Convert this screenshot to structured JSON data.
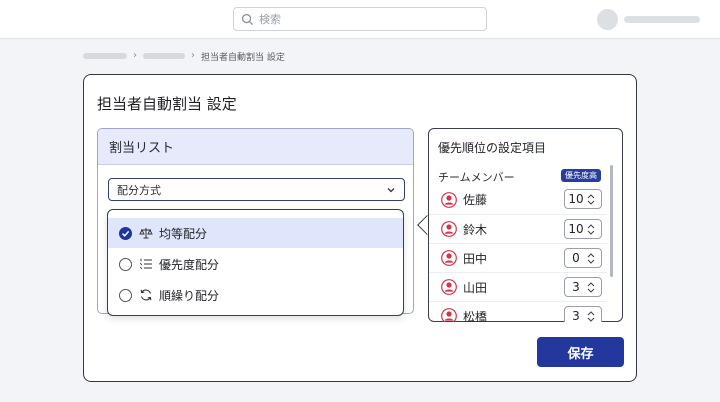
{
  "header": {
    "search_placeholder": "検索",
    "search_icon": "search-icon",
    "avatar_icon": "avatar"
  },
  "breadcrumb": {
    "current": "担当者自動割当 設定"
  },
  "page": {
    "title": "担当者自動割当 設定"
  },
  "assign_list": {
    "title": "割当リスト",
    "select_label": "配分方式",
    "options": [
      {
        "label": "均等配分",
        "icon": "balance-scale-icon",
        "selected": true
      },
      {
        "label": "優先度配分",
        "icon": "numbered-list-icon",
        "selected": false
      },
      {
        "label": "順繰り配分",
        "icon": "rotate-arrows-icon",
        "selected": false
      }
    ]
  },
  "priority": {
    "title": "優先順位の設定項目",
    "team_label": "チームメンバー",
    "badge": "優先度高",
    "members": [
      {
        "name": "佐藤",
        "value": "10"
      },
      {
        "name": "鈴木",
        "value": "10"
      },
      {
        "name": "田中",
        "value": "0"
      },
      {
        "name": "山田",
        "value": "3"
      },
      {
        "name": "松橋",
        "value": "3"
      }
    ]
  },
  "actions": {
    "save_label": "保存"
  },
  "colors": {
    "accent": "#23379c",
    "selected_option_bg": "#dfe6fb",
    "avatar_icon_color": "#d0354f"
  }
}
